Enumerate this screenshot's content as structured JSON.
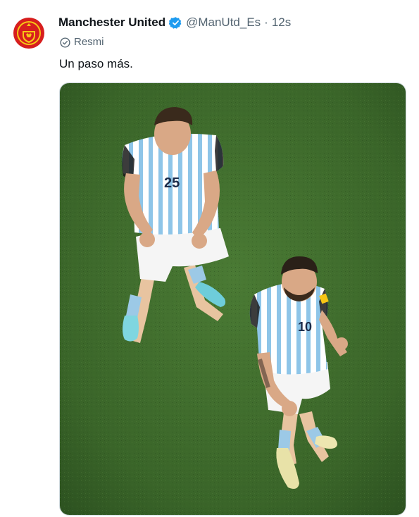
{
  "tweet": {
    "author_name": "Manchester United",
    "handle": "@ManUtd_Es",
    "separator": "·",
    "time": "12s",
    "badge_label": "Resmi",
    "text": "Un paso más."
  },
  "icons": {
    "avatar": "manchester-united-crest",
    "verified": "verified-check-icon",
    "badge": "official-check-circle-icon"
  },
  "media": {
    "jersey_numbers": [
      "25",
      "10"
    ]
  },
  "colors": {
    "verified_blue": "#1d9bf0",
    "secondary_text": "#536471",
    "pitch_green": "#3d6a2c",
    "crest_red": "#d71e1e",
    "crest_yellow": "#f6c515"
  }
}
